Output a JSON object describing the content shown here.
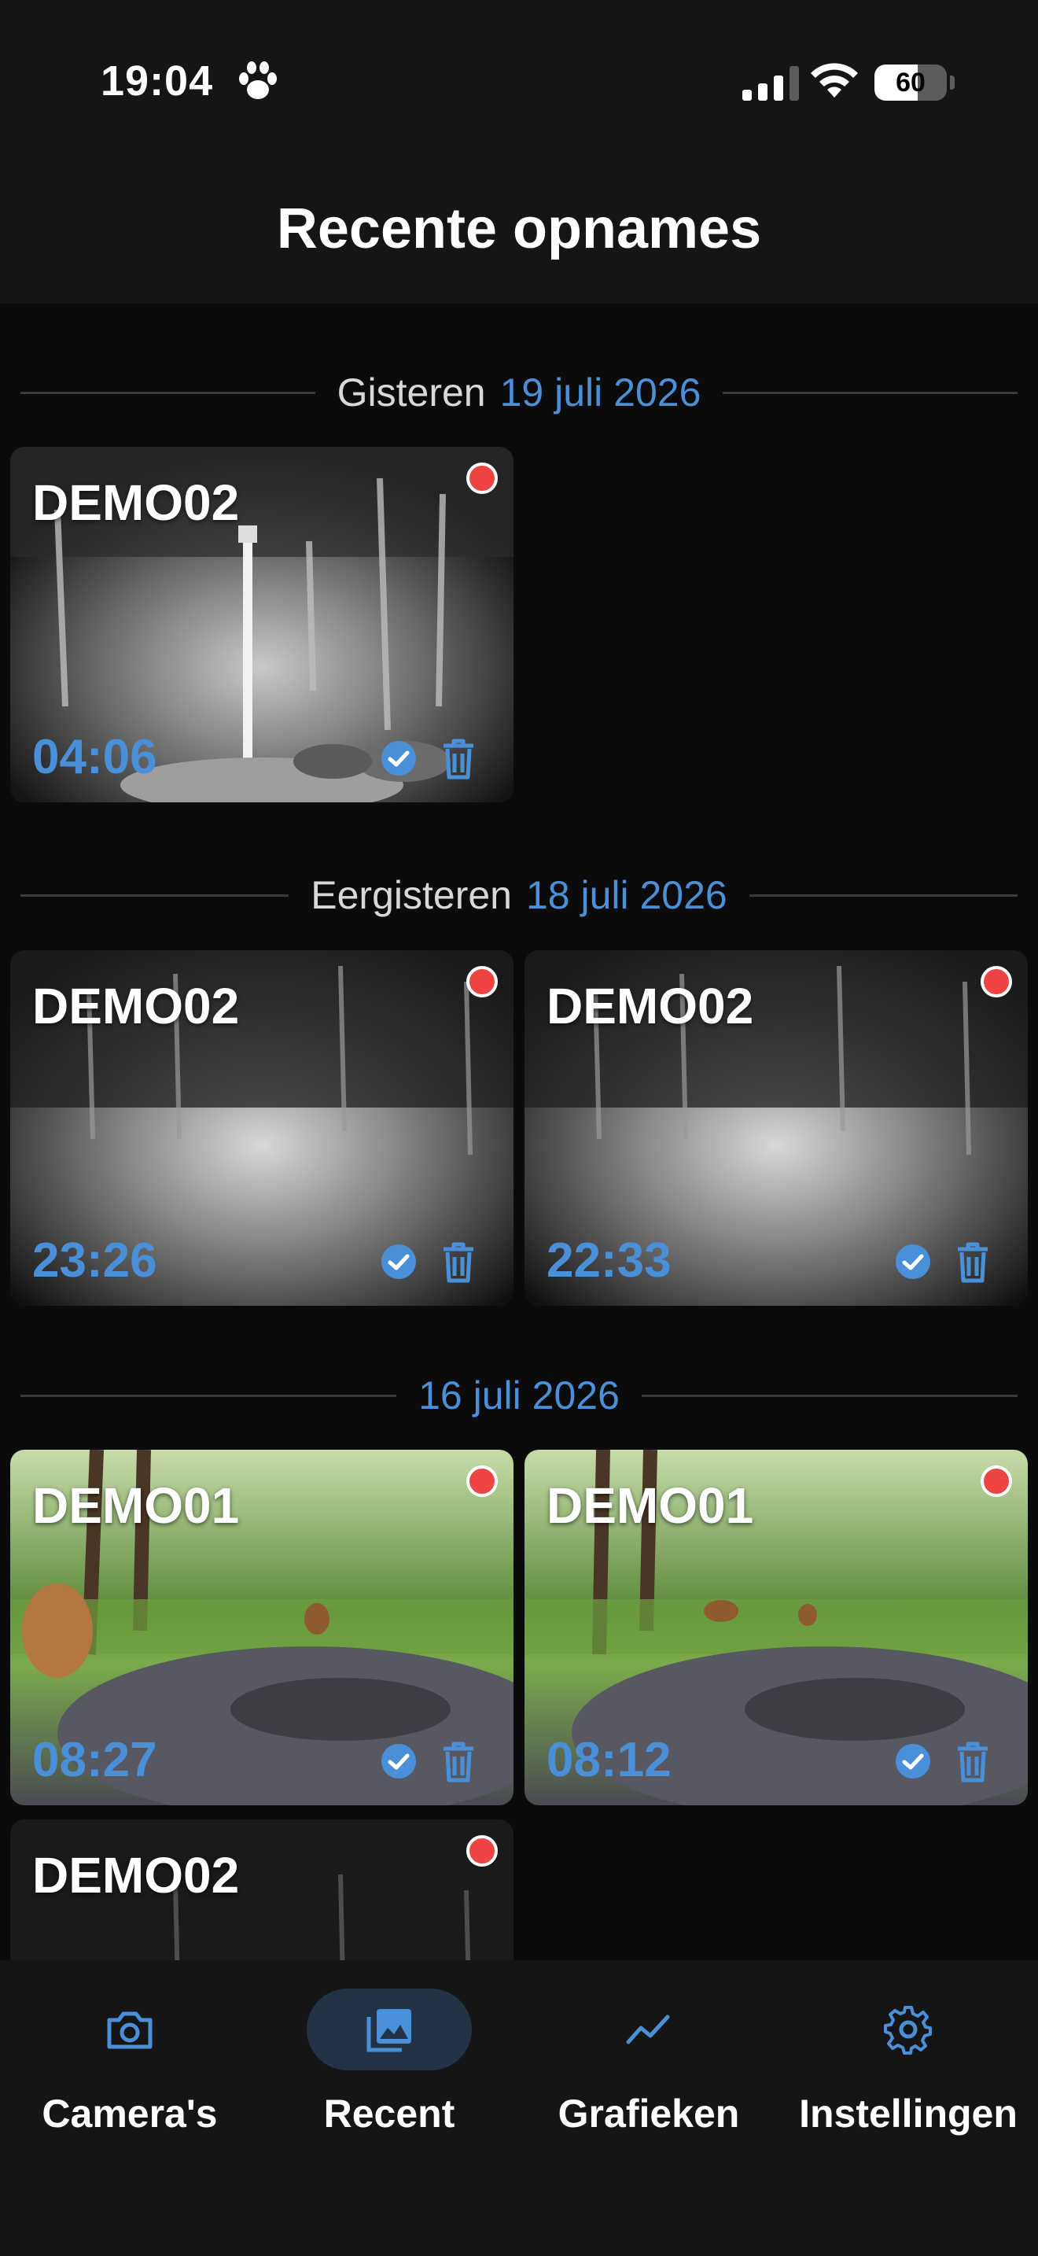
{
  "status_bar": {
    "time": "19:04",
    "battery": "60",
    "battery_level": 0.6
  },
  "header": {
    "title": "Recente opnames"
  },
  "sections": [
    {
      "label": "Gisteren",
      "date": "19 juli 2026",
      "cards": [
        {
          "camera": "DEMO02",
          "time": "04:06",
          "scene": "night-forest-pole"
        }
      ]
    },
    {
      "label": "Eergisteren",
      "date": "18 juli 2026",
      "cards": [
        {
          "camera": "DEMO02",
          "time": "23:26",
          "scene": "night-clearing"
        },
        {
          "camera": "DEMO02",
          "time": "22:33",
          "scene": "night-clearing"
        }
      ]
    },
    {
      "label": "",
      "date": "16 juli 2026",
      "cards": [
        {
          "camera": "DEMO01",
          "time": "08:27",
          "scene": "day-deer"
        },
        {
          "camera": "DEMO01",
          "time": "08:12",
          "scene": "day-deer"
        },
        {
          "camera": "DEMO02",
          "time": "",
          "scene": "night-clearing"
        }
      ]
    }
  ],
  "tabs": [
    {
      "label": "Camera's",
      "icon": "camera-icon",
      "active": false
    },
    {
      "label": "Recent",
      "icon": "photos-icon",
      "active": true
    },
    {
      "label": "Grafieken",
      "icon": "chart-line-icon",
      "active": false
    },
    {
      "label": "Instellingen",
      "icon": "gear-icon",
      "active": false
    }
  ],
  "colors": {
    "accent": "#4a90d9",
    "record_dot": "#ef4444",
    "background": "#0b0b0c",
    "bar": "#151516",
    "active_pill": "#243245"
  }
}
